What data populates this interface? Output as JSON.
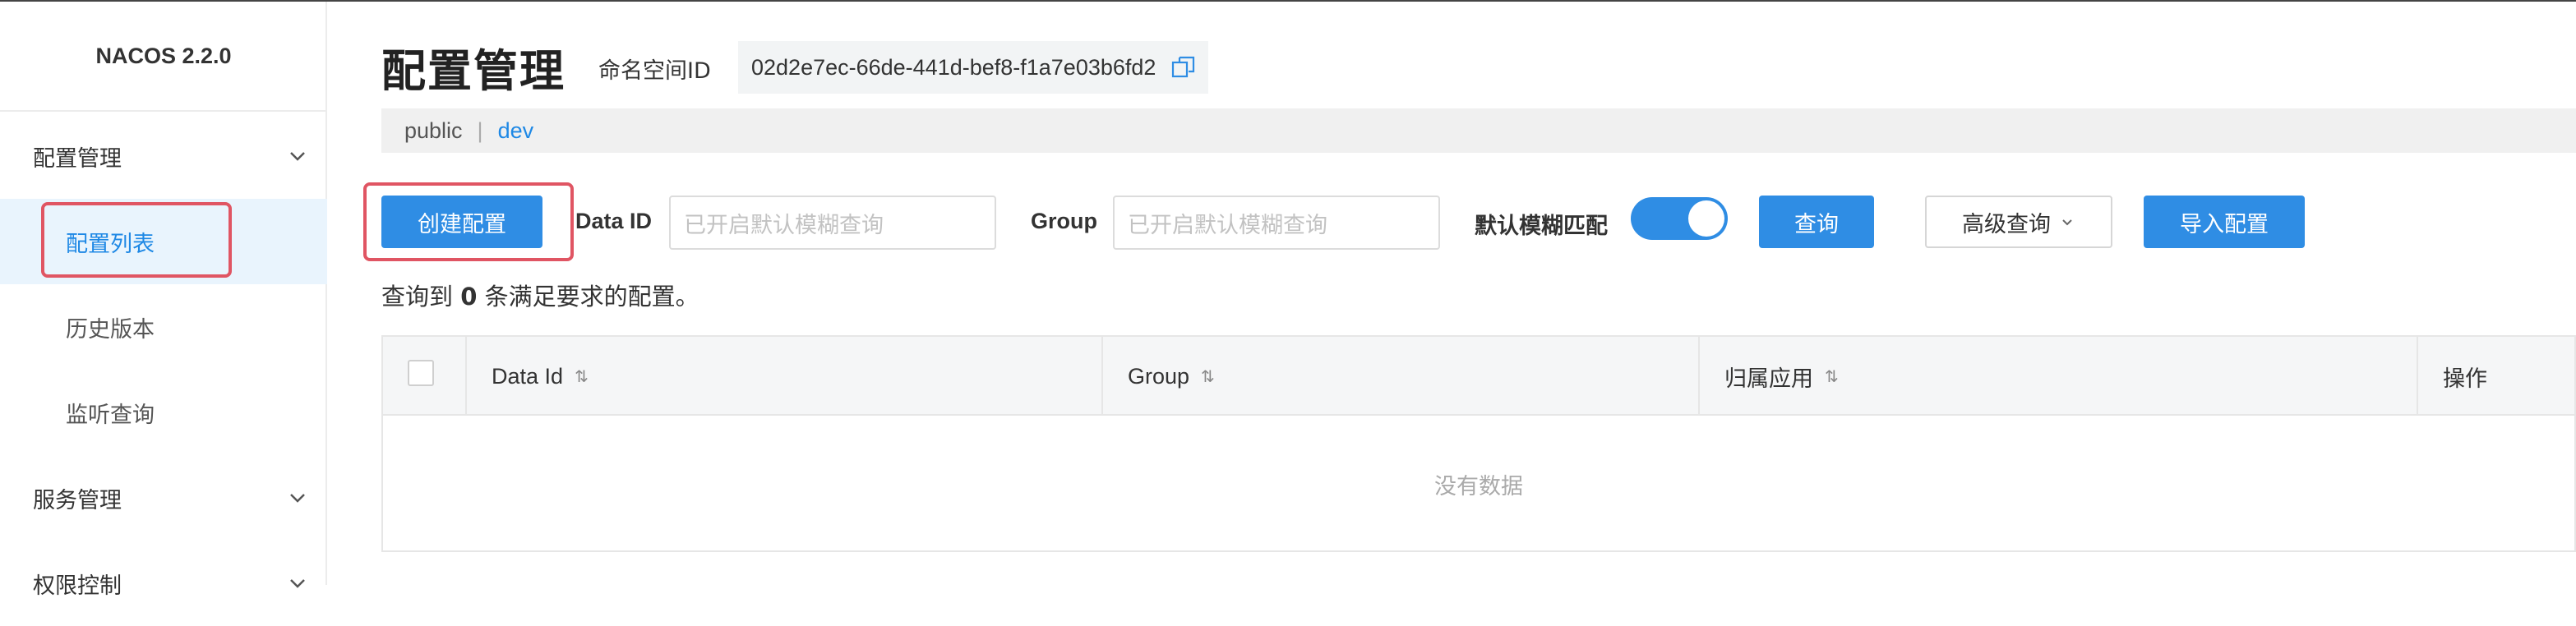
{
  "app": {
    "brand": "NACOS 2.2.0"
  },
  "sidebar": {
    "groups": [
      {
        "label": "配置管理",
        "items": [
          "配置列表",
          "历史版本",
          "监听查询"
        ]
      },
      {
        "label": "服务管理"
      },
      {
        "label": "权限控制"
      }
    ]
  },
  "header": {
    "title": "配置管理",
    "namespace_label": "命名空间ID",
    "namespace_id": "02d2e7ec-66de-441d-bef8-f1a7e03b6fd2"
  },
  "namespaces": {
    "items": [
      "public",
      "dev"
    ],
    "separator": "|",
    "selected": "dev"
  },
  "toolbar": {
    "create_label": "创建配置",
    "dataid_label": "Data ID",
    "dataid_placeholder": "已开启默认模糊查询",
    "group_label": "Group",
    "group_placeholder": "已开启默认模糊查询",
    "fuzzy_label": "默认模糊匹配",
    "fuzzy_on": true,
    "query_label": "查询",
    "advanced_label": "高级查询",
    "import_label": "导入配置"
  },
  "result": {
    "prefix": "查询到",
    "count": "0",
    "suffix": "条满足要求的配置。"
  },
  "table": {
    "columns": [
      "Data Id",
      "Group",
      "归属应用",
      "操作"
    ],
    "empty_text": "没有数据"
  },
  "colors": {
    "primary": "#2f8de4",
    "highlight": "#e05563",
    "active_bg": "#e9f4fd"
  },
  "icons": {
    "chevron": "chevron-down-icon",
    "copy": "copy-icon",
    "sort": "sort-icon"
  }
}
